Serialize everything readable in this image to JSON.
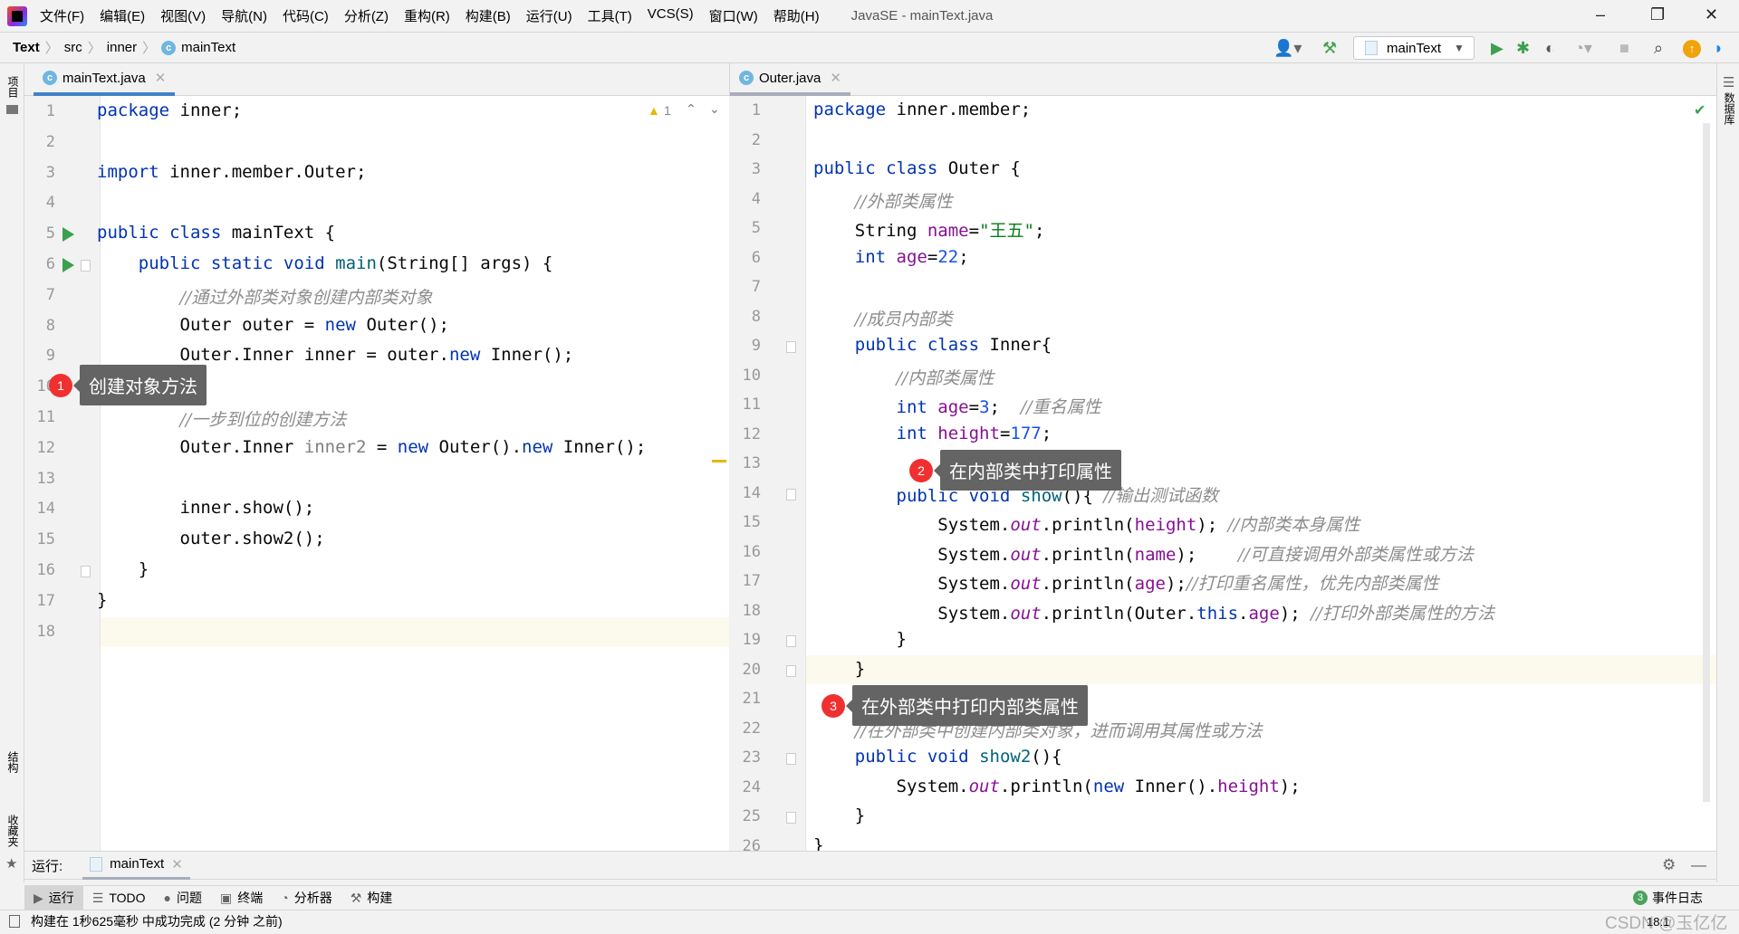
{
  "window": {
    "title": "JavaSE - mainText.java",
    "minimize": "–",
    "restore": "❐",
    "close": "✕"
  },
  "menu": [
    "文件(F)",
    "编辑(E)",
    "视图(V)",
    "导航(N)",
    "代码(C)",
    "分析(Z)",
    "重构(R)",
    "构建(B)",
    "运行(U)",
    "工具(T)",
    "VCS(S)",
    "窗口(W)",
    "帮助(H)"
  ],
  "breadcrumb": [
    "Text",
    "src",
    "inner",
    "mainText"
  ],
  "toolbar": {
    "run_config": "mainText",
    "icons": [
      "user-icon",
      "hammer-icon",
      "run-icon",
      "debug-icon",
      "coverage-icon",
      "profile-icon",
      "stop-icon",
      "search-icon",
      "update-icon",
      "plugin-icon"
    ]
  },
  "left_sidebar": {
    "project": "项目",
    "structure": "结构",
    "favorites": "收藏夹"
  },
  "right_sidebar": {
    "database": "数据库"
  },
  "left_editor": {
    "tab": "mainText.java",
    "warnings": "1",
    "current_line": 18,
    "run_lines": [
      5,
      6
    ],
    "lines": [
      [
        [
          "kw",
          "package"
        ],
        [
          "p",
          " inner;"
        ]
      ],
      [],
      [
        [
          "kw",
          "import"
        ],
        [
          "p",
          " inner.member.Outer;"
        ]
      ],
      [],
      [
        [
          "kw",
          "public class"
        ],
        [
          "p",
          " mainText {"
        ]
      ],
      [
        [
          "p",
          "    "
        ],
        [
          "kw",
          "public static void"
        ],
        [
          "p",
          " "
        ],
        [
          "fn",
          "main"
        ],
        [
          "p",
          "(String[] args) {"
        ]
      ],
      [
        [
          "p",
          "        "
        ],
        [
          "cm",
          "//通过外部类对象创建内部类对象"
        ]
      ],
      [
        [
          "p",
          "        Outer outer = "
        ],
        [
          "kw",
          "new"
        ],
        [
          "p",
          " Outer();"
        ]
      ],
      [
        [
          "p",
          "        Outer.Inner inner = outer."
        ],
        [
          "kw",
          "new"
        ],
        [
          "p",
          " Inner();"
        ]
      ],
      [],
      [
        [
          "p",
          "        "
        ],
        [
          "cm",
          "//一步到位的创建方法"
        ]
      ],
      [
        [
          "p",
          "        Outer.Inner "
        ],
        [
          "unused",
          "inner2"
        ],
        [
          "p",
          " = "
        ],
        [
          "kw",
          "new"
        ],
        [
          "p",
          " Outer()."
        ],
        [
          "kw",
          "new"
        ],
        [
          "p",
          " Inner();"
        ]
      ],
      [],
      [
        [
          "p",
          "        inner.show();"
        ]
      ],
      [
        [
          "p",
          "        outer.show2();"
        ]
      ],
      [
        [
          "p",
          "    }"
        ]
      ],
      [
        [
          "p",
          "}"
        ]
      ],
      []
    ]
  },
  "right_editor": {
    "tab": "Outer.java",
    "current_line": 20,
    "lines": [
      [
        [
          "kw",
          "package"
        ],
        [
          "p",
          " inner.member;"
        ]
      ],
      [],
      [
        [
          "kw",
          "public class"
        ],
        [
          "p",
          " Outer {"
        ]
      ],
      [
        [
          "p",
          "    "
        ],
        [
          "cm",
          "//外部类属性"
        ]
      ],
      [
        [
          "p",
          "    String "
        ],
        [
          "fld",
          "name"
        ],
        [
          "p",
          "="
        ],
        [
          "str",
          "\"王五\""
        ],
        [
          "p",
          ";"
        ]
      ],
      [
        [
          "p",
          "    "
        ],
        [
          "kw",
          "int"
        ],
        [
          "p",
          " "
        ],
        [
          "fld",
          "age"
        ],
        [
          "p",
          "="
        ],
        [
          "num",
          "22"
        ],
        [
          "p",
          ";"
        ]
      ],
      [],
      [
        [
          "p",
          "    "
        ],
        [
          "cm",
          "//成员内部类"
        ]
      ],
      [
        [
          "p",
          "    "
        ],
        [
          "kw",
          "public class"
        ],
        [
          "p",
          " Inner{"
        ]
      ],
      [
        [
          "p",
          "        "
        ],
        [
          "cm",
          "//内部类属性"
        ]
      ],
      [
        [
          "p",
          "        "
        ],
        [
          "kw",
          "int"
        ],
        [
          "p",
          " "
        ],
        [
          "fld",
          "age"
        ],
        [
          "p",
          "="
        ],
        [
          "num",
          "3"
        ],
        [
          "p",
          ";  "
        ],
        [
          "cm",
          "//重名属性"
        ]
      ],
      [
        [
          "p",
          "        "
        ],
        [
          "kw",
          "int"
        ],
        [
          "p",
          " "
        ],
        [
          "fld",
          "height"
        ],
        [
          "p",
          "="
        ],
        [
          "num",
          "177"
        ],
        [
          "p",
          ";"
        ]
      ],
      [],
      [
        [
          "p",
          "        "
        ],
        [
          "kw",
          "public void"
        ],
        [
          "p",
          " "
        ],
        [
          "fn",
          "show"
        ],
        [
          "p",
          "(){ "
        ],
        [
          "cm",
          "//输出测试函数"
        ]
      ],
      [
        [
          "p",
          "            System."
        ],
        [
          "st",
          "out"
        ],
        [
          "p",
          ".println("
        ],
        [
          "fld",
          "height"
        ],
        [
          "p",
          "); "
        ],
        [
          "cm",
          "//内部类本身属性"
        ]
      ],
      [
        [
          "p",
          "            System."
        ],
        [
          "st",
          "out"
        ],
        [
          "p",
          ".println("
        ],
        [
          "fld",
          "name"
        ],
        [
          "p",
          ");    "
        ],
        [
          "cm",
          "//可直接调用外部类属性或方法"
        ]
      ],
      [
        [
          "p",
          "            System."
        ],
        [
          "st",
          "out"
        ],
        [
          "p",
          ".println("
        ],
        [
          "fld",
          "age"
        ],
        [
          "p",
          ");"
        ],
        [
          "cm",
          "//打印重名属性，优先内部类属性"
        ]
      ],
      [
        [
          "p",
          "            System."
        ],
        [
          "st",
          "out"
        ],
        [
          "p",
          ".println(Outer."
        ],
        [
          "kw",
          "this"
        ],
        [
          "p",
          "."
        ],
        [
          "fld",
          "age"
        ],
        [
          "p",
          "); "
        ],
        [
          "cm",
          "//打印外部类属性的方法"
        ]
      ],
      [
        [
          "p",
          "        }"
        ]
      ],
      [
        [
          "p",
          "    }"
        ]
      ],
      [],
      [
        [
          "p",
          "    "
        ],
        [
          "cm",
          "//在外部类中创建内部类对象，进而调用其属性或方法"
        ]
      ],
      [
        [
          "p",
          "    "
        ],
        [
          "kw",
          "public void"
        ],
        [
          "p",
          " "
        ],
        [
          "fn",
          "show2"
        ],
        [
          "p",
          "(){"
        ]
      ],
      [
        [
          "p",
          "        System."
        ],
        [
          "st",
          "out"
        ],
        [
          "p",
          ".println("
        ],
        [
          "kw",
          "new"
        ],
        [
          "p",
          " Inner()."
        ],
        [
          "fld",
          "height"
        ],
        [
          "p",
          ");"
        ]
      ],
      [
        [
          "p",
          "    }"
        ]
      ],
      [
        [
          "p",
          "}"
        ]
      ]
    ]
  },
  "callouts": [
    {
      "number": "1",
      "text": "创建对象方法"
    },
    {
      "number": "2",
      "text": "在内部类中打印属性"
    },
    {
      "number": "3",
      "text": "在外部类中打印内部类属性"
    }
  ],
  "run_panel": {
    "label": "运行:",
    "tab": "mainText"
  },
  "tool_tabs": [
    "运行",
    "TODO",
    "问题",
    "终端",
    "分析器",
    "构建"
  ],
  "event_log": {
    "count": "3",
    "label": "事件日志"
  },
  "status": {
    "message": "构建在 1秒625毫秒 中成功完成 (2 分钟 之前)",
    "position": "18:1",
    "watermark": "CSDN @玉亿亿"
  },
  "colors": {
    "keyword": "#0033b3",
    "comment": "#8c8c8c",
    "field": "#871094",
    "string": "#067d17",
    "number": "#1750eb",
    "tab_active": "#4083c9",
    "callout_badge": "#f03030"
  }
}
